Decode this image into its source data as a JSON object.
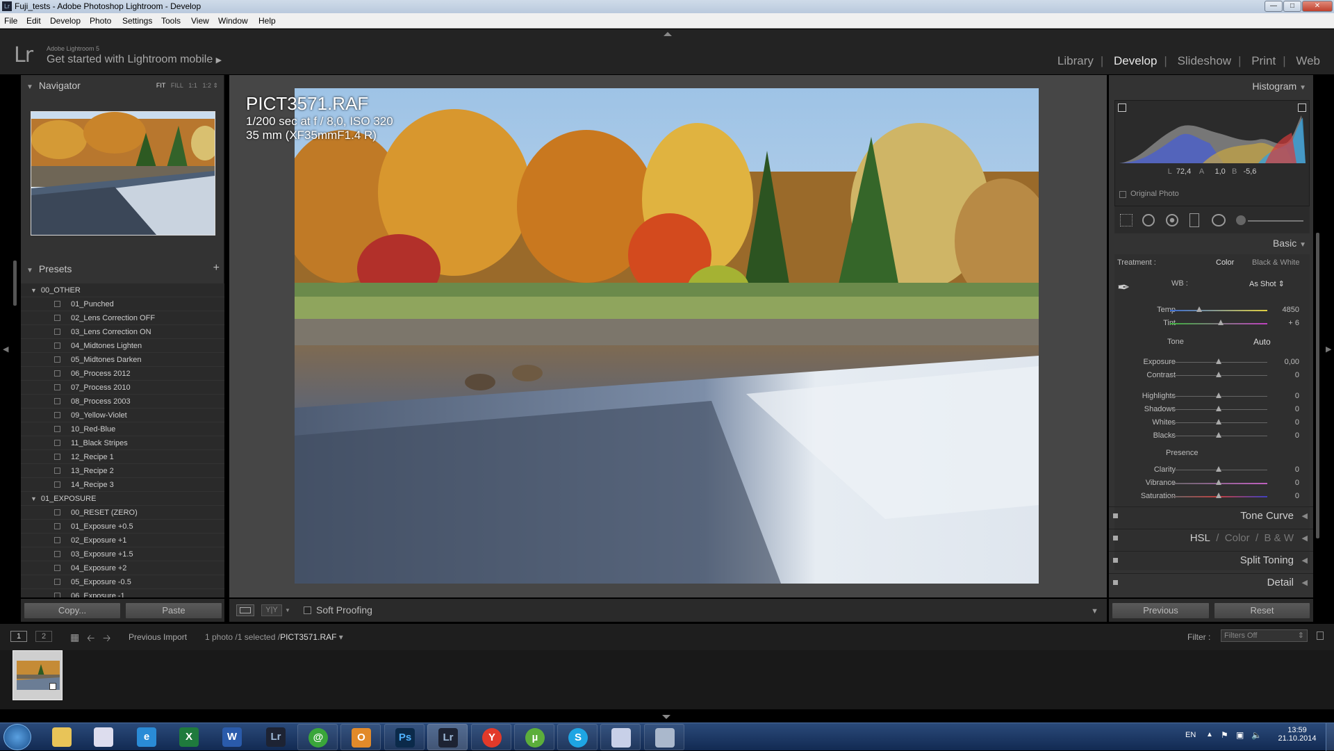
{
  "window": {
    "title": "Fuji_tests - Adobe Photoshop Lightroom - Develop",
    "app_icon": "Lr"
  },
  "menu": [
    "File",
    "Edit",
    "Develop",
    "Photo",
    "Settings",
    "Tools",
    "View",
    "Window",
    "Help"
  ],
  "identity": {
    "brand": "Adobe Lightroom 5",
    "mobile": "Get started with Lightroom mobile"
  },
  "modules": [
    "Library",
    "Develop",
    "Slideshow",
    "Print",
    "Web"
  ],
  "active_module": "Develop",
  "navigator": {
    "title": "Navigator",
    "zoom": [
      "FIT",
      "FILL",
      "1:1",
      "1:2"
    ]
  },
  "presets": {
    "title": "Presets",
    "folders": [
      {
        "name": "00_OTHER",
        "items": [
          "01_Punched",
          "02_Lens Correction OFF",
          "03_Lens Correction ON",
          "04_Midtones Lighten",
          "05_Midtones Darken",
          "06_Process 2012",
          "07_Process 2010",
          "08_Process 2003",
          "09_Yellow-Violet",
          "10_Red-Blue",
          "11_Black Stripes",
          "12_Recipe 1",
          "13_Recipe 2",
          "14_Recipe 3"
        ]
      },
      {
        "name": "01_EXPOSURE",
        "items": [
          "00_RESET (ZERO)",
          "01_Exposure +0.5",
          "02_Exposure +1",
          "03_Exposure +1.5",
          "04_Exposure +2",
          "05_Exposure -0.5",
          "06_Exposure -1"
        ]
      }
    ]
  },
  "left_buttons": {
    "copy": "Copy...",
    "paste": "Paste"
  },
  "photo_info": {
    "filename": "PICT3571.RAF",
    "exposure": "1/200 sec at f / 8,0, ISO 320",
    "lens": "35 mm (XF35mmF1.4 R)"
  },
  "toolbar": {
    "soft_proofing": "Soft Proofing"
  },
  "histogram": {
    "title": "Histogram",
    "readout": [
      "L",
      "72,4",
      "A",
      "1,0",
      "B",
      "-5,6"
    ],
    "original": "Original Photo"
  },
  "basic": {
    "title": "Basic",
    "treatment_label": "Treatment :",
    "treatment_color": "Color",
    "treatment_bw": "Black & White",
    "wb_label": "WB :",
    "wb_value": "As Shot",
    "tone_label": "Tone",
    "auto_label": "Auto",
    "presence_label": "Presence",
    "sliders": [
      {
        "label": "Temp",
        "value": "4850",
        "pos": 0.3
      },
      {
        "label": "Tint",
        "value": "+ 6",
        "pos": 0.52
      },
      {
        "label": "Exposure",
        "value": "0,00",
        "pos": 0.5
      },
      {
        "label": "Contrast",
        "value": "0",
        "pos": 0.5
      },
      {
        "label": "Highlights",
        "value": "0",
        "pos": 0.5
      },
      {
        "label": "Shadows",
        "value": "0",
        "pos": 0.5
      },
      {
        "label": "Whites",
        "value": "0",
        "pos": 0.5
      },
      {
        "label": "Blacks",
        "value": "0",
        "pos": 0.5
      },
      {
        "label": "Clarity",
        "value": "0",
        "pos": 0.5
      },
      {
        "label": "Vibrance",
        "value": "0",
        "pos": 0.5
      },
      {
        "label": "Saturation",
        "value": "0",
        "pos": 0.5
      }
    ]
  },
  "sections": {
    "tone_curve": "Tone Curve",
    "hsl": "HSL",
    "hsl_sep": "/",
    "color": "Color",
    "bw": "B & W",
    "split": "Split Toning",
    "detail": "Detail"
  },
  "right_buttons": {
    "previous": "Previous",
    "reset": "Reset"
  },
  "filmbar": {
    "view1": "1",
    "view2": "2",
    "source": "Previous Import",
    "count": "1 photo /1 selected /",
    "file": "PICT3571.RAF",
    "filter_label": "Filter :",
    "filter_value": "Filters Off"
  },
  "taskbar": {
    "lang": "EN",
    "time": "13:59",
    "date": "21.10.2014"
  },
  "colors": {
    "accent": "#e8e8e8",
    "panel": "#333333",
    "center": "#464646",
    "taskbar": "#1b3a6a"
  }
}
